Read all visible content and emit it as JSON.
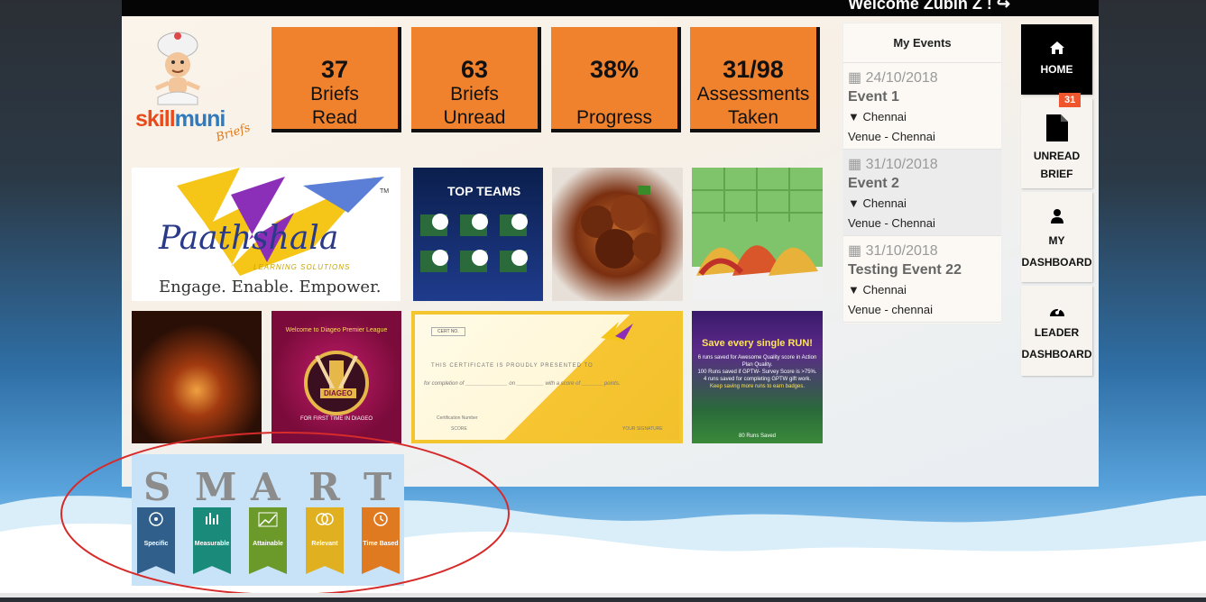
{
  "header": {
    "welcome": "Welcome Zubin Z !"
  },
  "logo": {
    "part1": "skill",
    "part2": "muni",
    "sub": "Briefs"
  },
  "stats": [
    {
      "value": "37",
      "line1": "Briefs",
      "line2": "Read"
    },
    {
      "value": "63",
      "line1": "Briefs",
      "line2": "Unread"
    },
    {
      "value": "38%",
      "line1": "",
      "line2": "Progress"
    },
    {
      "value": "31/98",
      "line1": "Assessments",
      "line2": "Taken"
    }
  ],
  "tiles": {
    "paathshala": {
      "name": "Paathshala",
      "sub": "LEARNING SOLUTIONS",
      "tag": "Engage. Enable. Empower.",
      "tm": "TM"
    },
    "teams": {
      "title": "TOP TEAMS"
    },
    "premier": {
      "title": "Welcome to Diageo Premier League",
      "badge": "DIAGEO",
      "line": "FOR FIRST TIME IN DIAGEO"
    },
    "certificate": {
      "no": "CERT NO.",
      "presented": "THIS CERTIFICATE IS PROUDLY PRESENTED TO",
      "completion": "for completion of ______________ on _________ with a score of _______ points.",
      "certno": "Certification Number",
      "score": "SCORE",
      "signature": "YOUR SIGNATURE"
    },
    "runs": {
      "title": "Save every single RUN!",
      "l1": "6 runs saved for Awesome Quality score in Action Plan Quality.",
      "l2": "100 Runs saved if GPTW- Survey Score is >75%.",
      "l3": "4 runs saved for completing GPTW gift work.",
      "l4": "Keep saving more runs to earn badges.",
      "foot": "80 Runs Saved"
    }
  },
  "events": {
    "title": "My Events",
    "items": [
      {
        "date": "24/10/2018",
        "title": "Event 1",
        "location": "Chennai",
        "venue": "Venue - Chennai"
      },
      {
        "date": "31/10/2018",
        "title": "Event 2",
        "location": "Chennai",
        "venue": "Venue - Chennai"
      },
      {
        "date": "31/10/2018",
        "title": "Testing Event 22",
        "location": "Chennai",
        "venue": "Venue - chennai"
      }
    ]
  },
  "nav": {
    "home": "HOME",
    "unread_line1": "UNREAD",
    "unread_line2": "BRIEF",
    "unread_badge": "31",
    "my_line1": "MY",
    "my_line2": "DASHBOARD",
    "leader_line1": "LEADER",
    "leader_line2": "DASHBOARD"
  },
  "smart": {
    "letters": [
      "S",
      "M",
      "A",
      "R",
      "T"
    ],
    "labels": [
      "Specific",
      "Measurable",
      "Attainable",
      "Relevant",
      "Time Based"
    ],
    "colors": [
      "#2f5f8a",
      "#1a8a7a",
      "#6b9a2a",
      "#e0b020",
      "#e07a20"
    ]
  },
  "colors": {
    "stat": "#f0822d",
    "annotation": "#d62b2b"
  }
}
